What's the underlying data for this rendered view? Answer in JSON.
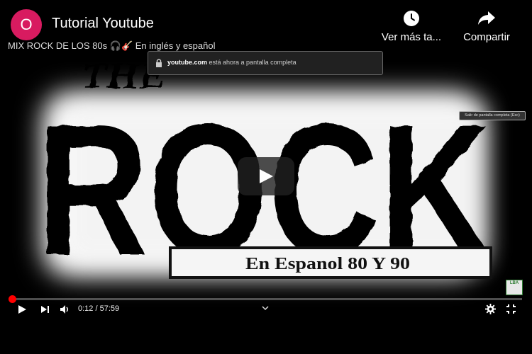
{
  "header": {
    "avatar_letter": "O",
    "channel_title": "Tutorial Youtube",
    "video_title": "MIX ROCK DE LOS 80s 🎧🎸 En inglés y español",
    "watch_later_label": "Ver más ta...",
    "share_label": "Compartir"
  },
  "toast": {
    "domain": "youtube.com",
    "message": " está ahora a pantalla completa",
    "exit_label": "Salir de pantalla completa (Esc)"
  },
  "artwork": {
    "logo_small": "THE",
    "logo_main": "ROCK",
    "banner": "En Espanol 80 Y 90",
    "badge": "LBA"
  },
  "player": {
    "current_time": "0:12",
    "duration": "57:59",
    "time_display": "0:12 / 57:59",
    "progress_fraction": 0.0035
  },
  "icons": [
    "play-icon",
    "next-icon",
    "volume-icon",
    "chevron-down-icon",
    "settings-icon",
    "exit-fullscreen-icon",
    "clock-icon",
    "share-icon",
    "lock-icon"
  ],
  "colors": {
    "avatar": "#d81b60",
    "progress": "#ff0000",
    "background": "#000000"
  }
}
